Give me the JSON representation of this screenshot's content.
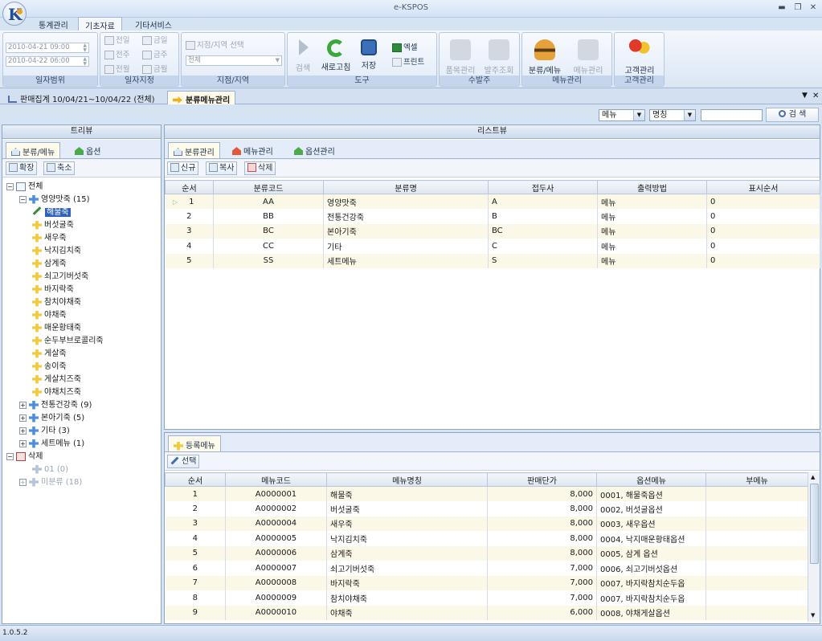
{
  "app": {
    "title": "e-KSPOS",
    "version": "1.0.5.2"
  },
  "menu_tabs": [
    {
      "label": "통계관리"
    },
    {
      "label": "기초자료"
    },
    {
      "label": "기타서비스"
    }
  ],
  "ribbon": {
    "date_range": {
      "from": "2010-04-21 09:00",
      "to": "2010-04-22 06:00",
      "label": "일자범위"
    },
    "date_designate": {
      "prev_day": "전일",
      "prev_week": "전주",
      "prev_month": "전월",
      "today": "금일",
      "this_week": "금주",
      "this_month": "금월",
      "label": "일자지정"
    },
    "branch": {
      "select_label": "지점/지역 선택",
      "value": "전체",
      "label": "지점/지역"
    },
    "tools": {
      "search": "검색",
      "refresh": "새로고침",
      "save": "저장",
      "excel": "엑셀",
      "print": "프린트",
      "label": "도구"
    },
    "order": {
      "item_mgmt": "품목관리",
      "order_inquiry": "발주조회",
      "label": "수발주"
    },
    "menu_mgmt": {
      "category_menu": "분류/메뉴",
      "menu_mgmt": "메뉴관리",
      "label": "메뉴관리"
    },
    "customer": {
      "customer_mgmt": "고객관리",
      "label": "고객관리"
    }
  },
  "doc_tabs": [
    {
      "label": "판매집계 10/04/21~10/04/22 (전체)"
    },
    {
      "label": "분류메뉴관리"
    }
  ],
  "search": {
    "type_value": "메뉴",
    "field_value": "명칭",
    "query": "",
    "button": "검 색"
  },
  "tree_panel": {
    "title": "트리뷰",
    "tabs": [
      {
        "label": "분류/메뉴"
      },
      {
        "label": "옵션"
      }
    ],
    "expand": "확장",
    "collapse": "축소",
    "root": "전체",
    "group1": "영양맛죽 (15)",
    "group1_children": [
      "해물죽",
      "버섯굴죽",
      "새우죽",
      "낙지김치죽",
      "삼계죽",
      "쇠고기버섯죽",
      "바지락죽",
      "참치야채죽",
      "야채죽",
      "매운황태죽",
      "순두부브로콜리죽",
      "게살죽",
      "송이죽",
      "게살치즈죽",
      "야채치즈죽"
    ],
    "groups": [
      "전통건강죽 (9)",
      "본아기죽 (5)",
      "기타 (3)",
      "세트메뉴 (1)"
    ],
    "deleted": "삭제",
    "deleted_children": [
      "01 (0)",
      "미분류 (18)"
    ]
  },
  "list_panel": {
    "title": "리스트뷰",
    "tabs": [
      {
        "label": "분류관리"
      },
      {
        "label": "메뉴관리"
      },
      {
        "label": "옵션관리"
      }
    ],
    "buttons": {
      "new": "신규",
      "copy": "복사",
      "delete": "삭제"
    },
    "columns": [
      "순서",
      "분류코드",
      "분류명",
      "접두사",
      "출력방법",
      "표시순서"
    ],
    "rows": [
      [
        "1",
        "AA",
        "영양맛죽",
        "A",
        "메뉴",
        "0"
      ],
      [
        "2",
        "BB",
        "전통건강죽",
        "B",
        "메뉴",
        "0"
      ],
      [
        "3",
        "BC",
        "본아기죽",
        "BC",
        "메뉴",
        "0"
      ],
      [
        "4",
        "CC",
        "기타",
        "C",
        "메뉴",
        "0"
      ],
      [
        "5",
        "SS",
        "세트메뉴",
        "S",
        "메뉴",
        "0"
      ]
    ]
  },
  "reg_panel": {
    "tab": "등록메뉴",
    "select_button": "선택",
    "columns": [
      "순서",
      "메뉴코드",
      "메뉴명칭",
      "판매단가",
      "옵션메뉴",
      "부메뉴"
    ],
    "rows": [
      [
        "1",
        "A0000001",
        "해물죽",
        "8,000",
        "0001, 해물죽옵션",
        ""
      ],
      [
        "2",
        "A0000002",
        "버섯굴죽",
        "8,000",
        "0002, 버섯굴옵션",
        ""
      ],
      [
        "3",
        "A0000004",
        "새우죽",
        "8,000",
        "0003, 새우옵션",
        ""
      ],
      [
        "4",
        "A0000005",
        "낙지김치죽",
        "8,000",
        "0004, 낙지매운황태옵션",
        ""
      ],
      [
        "5",
        "A0000006",
        "삼계죽",
        "8,000",
        "0005, 삼계 옵션",
        ""
      ],
      [
        "6",
        "A0000007",
        "쇠고기버섯죽",
        "7,000",
        "0006, 쇠고기버섯옵션",
        ""
      ],
      [
        "7",
        "A0000008",
        "바지락죽",
        "7,000",
        "0007, 바지락참치순두옵",
        ""
      ],
      [
        "8",
        "A0000009",
        "참치야채죽",
        "7,000",
        "0007, 바지락참치순두옵",
        ""
      ],
      [
        "9",
        "A0000010",
        "야채죽",
        "6,000",
        "0008, 야채게살옵션",
        ""
      ]
    ]
  }
}
